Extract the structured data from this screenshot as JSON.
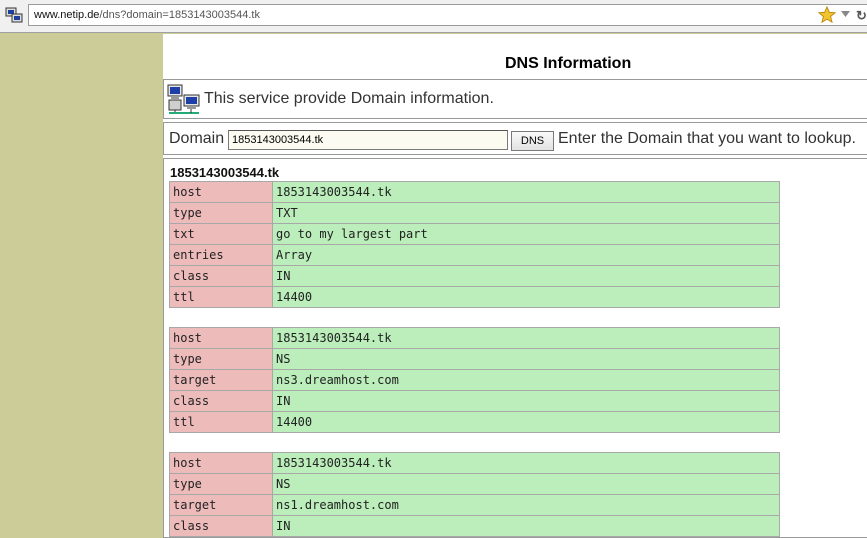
{
  "browser": {
    "url_host": "www.netip.de",
    "url_path": "/dns?domain=1853143003544.tk"
  },
  "page": {
    "title": "DNS Information",
    "service_text": "This service provide Domain information.",
    "form": {
      "label": "Domain",
      "value": "1853143003544.tk",
      "button_label": "DNS",
      "hint": "Enter the Domain that you want to lookup."
    },
    "results_heading": "1853143003544.tk",
    "records": [
      [
        {
          "key": "host",
          "value": "1853143003544.tk"
        },
        {
          "key": "type",
          "value": "TXT"
        },
        {
          "key": "txt",
          "value": "go to my largest part"
        },
        {
          "key": "entries",
          "value": "Array"
        },
        {
          "key": "class",
          "value": "IN"
        },
        {
          "key": "ttl",
          "value": "14400"
        }
      ],
      [
        {
          "key": "host",
          "value": "1853143003544.tk"
        },
        {
          "key": "type",
          "value": "NS"
        },
        {
          "key": "target",
          "value": "ns3.dreamhost.com"
        },
        {
          "key": "class",
          "value": "IN"
        },
        {
          "key": "ttl",
          "value": "14400"
        }
      ],
      [
        {
          "key": "host",
          "value": "1853143003544.tk"
        },
        {
          "key": "type",
          "value": "NS"
        },
        {
          "key": "target",
          "value": "ns1.dreamhost.com"
        },
        {
          "key": "class",
          "value": "IN"
        }
      ]
    ]
  },
  "colors": {
    "background": "#cccc99",
    "key_cell": "#eebbbb",
    "value_cell": "#bbeebb"
  },
  "icons": [
    "site-icon",
    "star-icon",
    "dropdown-icon",
    "reload-icon",
    "network-computers-icon"
  ]
}
